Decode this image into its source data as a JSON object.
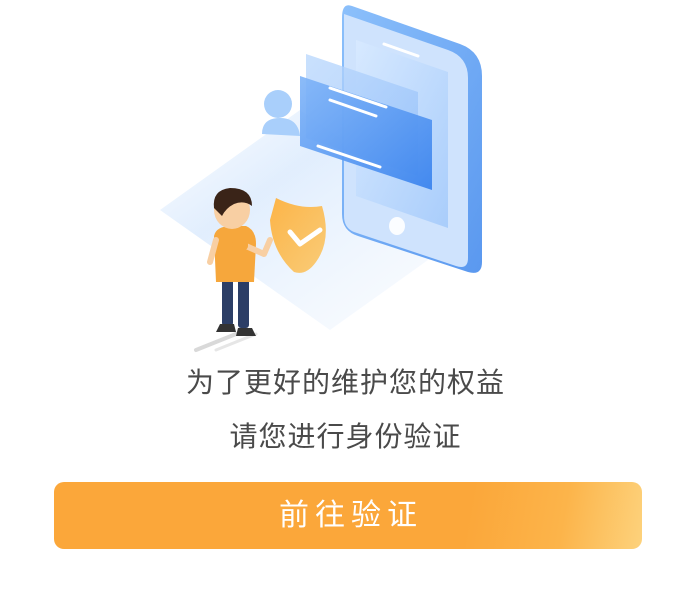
{
  "message": {
    "line1": "为了更好的维护您的权益",
    "line2": "请您进行身份验证"
  },
  "action": {
    "button_label": "前往验证"
  },
  "colors": {
    "accent": "#fba73a",
    "accent_light": "#fdd27c",
    "text": "#4a4a4a",
    "phone_blue": "#6fa8f5"
  },
  "illustration": {
    "icons": [
      "phone-icon",
      "user-badge-icon",
      "shield-check-icon",
      "person-figure"
    ]
  }
}
